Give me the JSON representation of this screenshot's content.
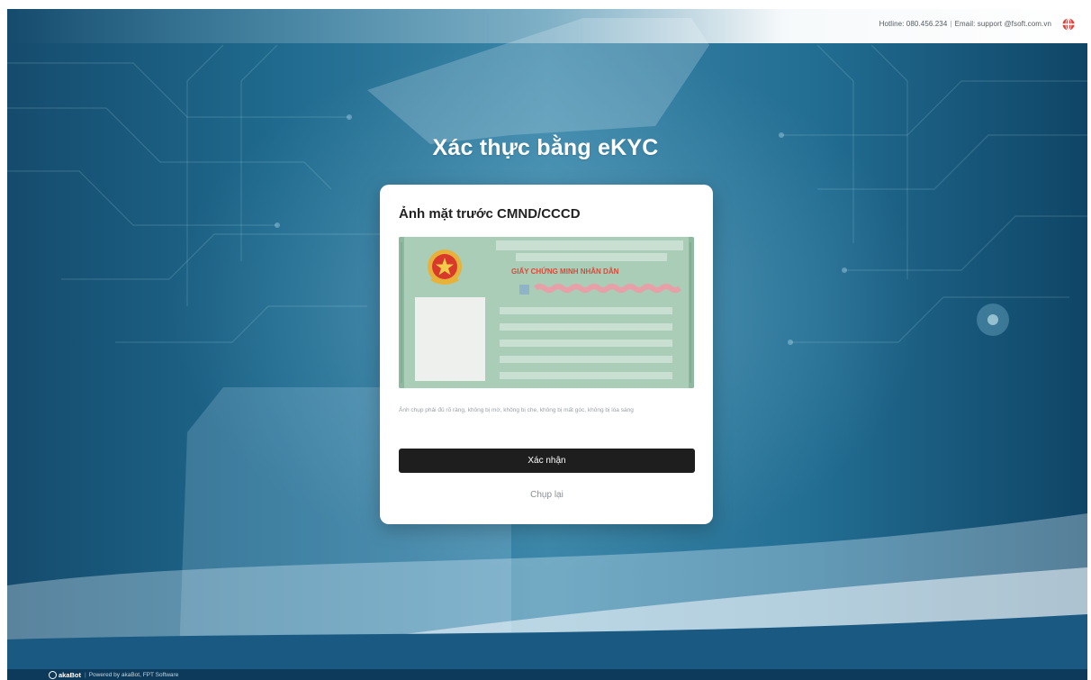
{
  "header": {
    "hotline_label": "Hotline: 080.456.234",
    "email_label": "Email: support @fsoft.com.vn",
    "separator": "|",
    "language_icon": "globe-flag-icon"
  },
  "page": {
    "title": "Xác thực bằng eKYC"
  },
  "card": {
    "title": "Ảnh mặt trước CMND/CCCD",
    "id_card_heading": "GIẤY CHỨNG MINH NHÂN DÂN",
    "hint": "Ảnh chụp phải đủ rõ ràng, không bị mờ, không bị che, không bị mất góc, không bị lóa sáng",
    "confirm_label": "Xác nhận",
    "retake_label": "Chụp lại"
  },
  "footer": {
    "brand": "akaBot",
    "separator": "|",
    "powered_by": "Powered by akaBot, FPT Software"
  },
  "colors": {
    "primary_button": "#1e1e1e",
    "card_background": "#ffffff",
    "id_card_green": "#a9cdb7",
    "id_card_red": "#d84a3a",
    "footer_background": "#0d3a5a"
  }
}
